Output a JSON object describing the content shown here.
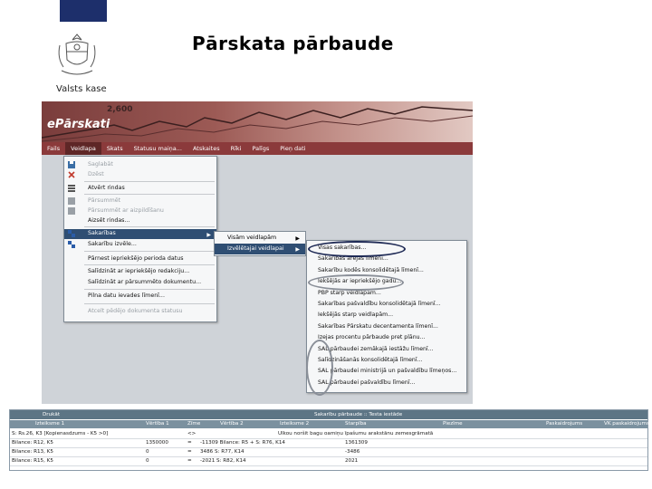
{
  "slide": {
    "title": "Pārskata pārbaude",
    "org": "Valsts kase"
  },
  "app": {
    "brand": "ePārskati",
    "banner_number": "2,600",
    "menu": [
      "Fails",
      "Veidlapa",
      "Skats",
      "Statusu maiņa...",
      "Atskaites",
      "Rīki",
      "Palīgs",
      "Pieņ dati"
    ],
    "active_menu_index": 1
  },
  "dropdown": {
    "items": [
      {
        "label": "Saglabāt",
        "icon": "save-icon",
        "disabled": true
      },
      {
        "label": "Dzēst",
        "icon": "delete-icon",
        "disabled": true
      },
      {
        "label": "Atvērt rindas",
        "icon": "rows-icon",
        "disabled": false
      },
      {
        "label": "Pārsummēt",
        "icon": "sum-icon",
        "disabled": true
      },
      {
        "label": "Pārsummēt ar aizpildīšanu",
        "icon": "sum-icon",
        "disabled": true
      },
      {
        "label": "Aizsēt rindas...",
        "icon": "",
        "disabled": false
      },
      {
        "label": "Sakarības",
        "icon": "links-icon",
        "disabled": false,
        "selected": true
      },
      {
        "label": "Sakarību izvēle...",
        "icon": "links-icon",
        "disabled": false
      },
      {
        "label": "Pārnest iepriekšējo perioda datus",
        "icon": "",
        "disabled": false
      },
      {
        "label": "Salīdzināt ar iepriekšējo redakciju...",
        "icon": "",
        "disabled": false
      },
      {
        "label": "Salīdzināt ar pārsummēto dokumentu...",
        "icon": "",
        "disabled": false
      },
      {
        "label": "Pilna datu ievades līmenī...",
        "icon": "",
        "disabled": false
      },
      {
        "label": "Atcelt pēdējo dokumenta statusu",
        "icon": "",
        "disabled": true
      }
    ]
  },
  "submenu1": {
    "items": [
      "Visām veidlapām",
      "Izvēlētajai veidlapai"
    ],
    "selected_index": 1
  },
  "submenu2": {
    "items": [
      "Visas sakarības...",
      "Sakarības ārējās līmenī...",
      "Sakarību kodēs konsolidētajā līmenī...",
      "Iekšējās ar iepriekšējo gadu...",
      "PBP starp veidlapām...",
      "Sakarības pašvaldību konsolidētajā līmenī...",
      "Iekšējās starp veidlapām...",
      "Sakarības Pārskatu decentamenta līmenī...",
      "Izejas procentu pārbaude pret plānu...",
      "SAL pārbaudei zemākajā iestāžu līmenī...",
      "Salīdzināšanās konsolidētajā līmenī...",
      "SAL pārbaudei ministrijā un pašvaldību līmeņos...",
      "SAL pārbaudei pašvaldību līmenī..."
    ]
  },
  "grid": {
    "toolbar": "Drukāt",
    "title": "Sakarību pārbaude :: Testa iestāde",
    "columns": [
      "Izteiksme 1",
      "Vērtība 1",
      "Zīme",
      "Vērtība 2",
      "Izteiksme 2",
      "Starpība",
      "Piezīme",
      "Paskaidrojums",
      "VK paskaidrojums"
    ],
    "rows": [
      [
        "S: Rs.26, K3 [Kopienasdzums - K5 >0]",
        "",
        "<>",
        "",
        "",
        "",
        "Ulkou noršit bagu oamiņu īpašumu arakstānu zemesgrāmatā",
        "",
        ""
      ],
      [
        "Bilance: R12, K5",
        "1350000",
        "=",
        "-11309 Bilance: R5 + S: R76, K14",
        "",
        "1361309",
        "",
        "",
        ""
      ],
      [
        "Bilance: R13, K5",
        "0",
        "=",
        "3486 S: R77, K14",
        "",
        "-3486",
        "",
        "",
        ""
      ],
      [
        "Bilance: R15, K5",
        "0",
        "=",
        "-2021 S: R82, K14",
        "",
        "2021",
        "",
        "",
        ""
      ]
    ]
  },
  "colors": {
    "menubar": "#8b3a3b",
    "selection": "#2f4e73",
    "annotation_oval": "#1e2a55"
  }
}
